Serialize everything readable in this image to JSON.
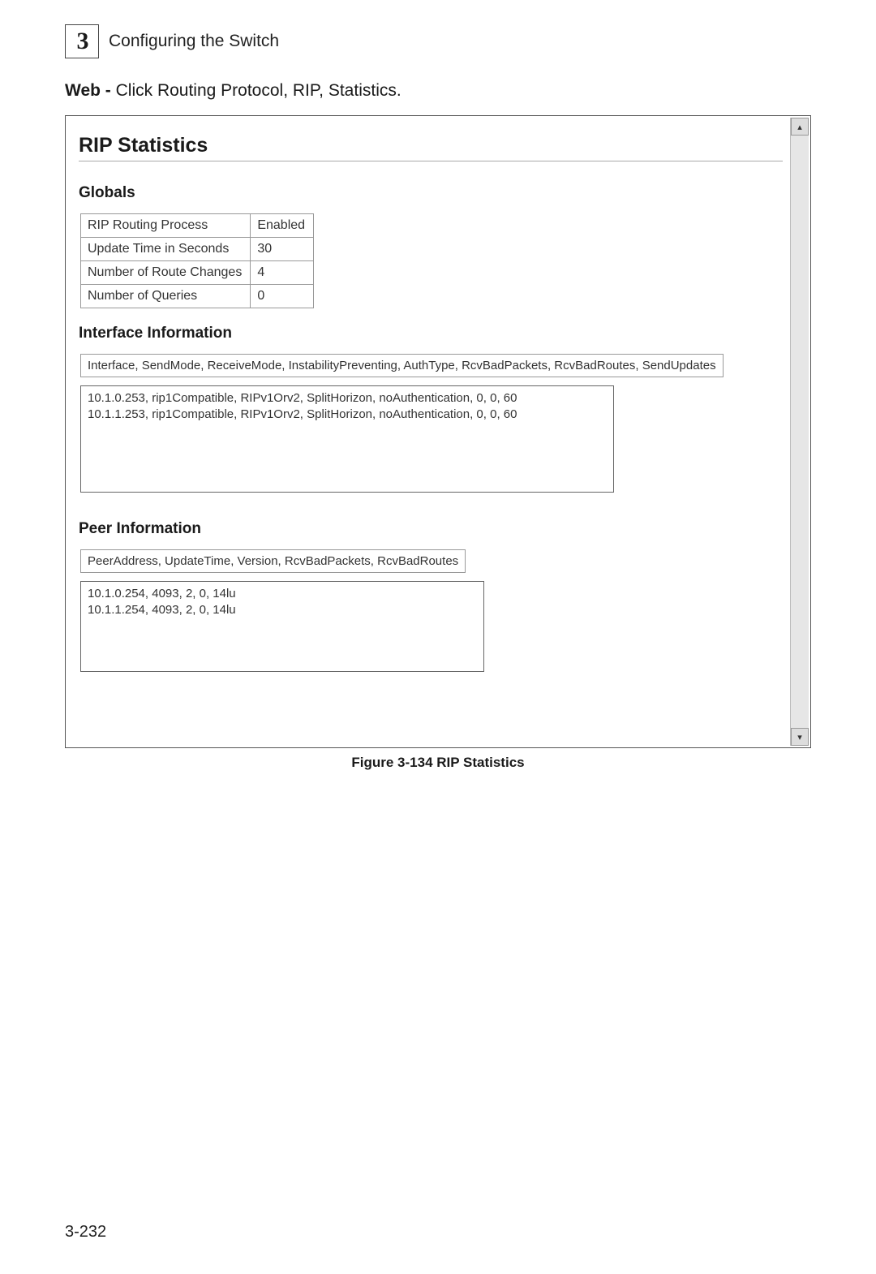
{
  "chapter": {
    "number": "3",
    "title": "Configuring the Switch"
  },
  "intro_prefix": "Web -",
  "intro_suffix": " Click Routing Protocol, RIP, Statistics.",
  "panel": {
    "title": "RIP Statistics",
    "globals_heading": "Globals",
    "globals_rows": [
      {
        "label": "RIP Routing Process",
        "value": "Enabled"
      },
      {
        "label": "Update Time in Seconds",
        "value": "30"
      },
      {
        "label": "Number of Route Changes",
        "value": "4"
      },
      {
        "label": "Number of Queries",
        "value": "0"
      }
    ],
    "iface_heading": "Interface Information",
    "iface_columns": "Interface, SendMode, ReceiveMode, InstabilityPreventing, AuthType, RcvBadPackets, RcvBadRoutes, SendUpdates",
    "iface_rows": [
      "10.1.0.253, rip1Compatible, RIPv1Orv2, SplitHorizon, noAuthentication, 0, 0, 60",
      "10.1.1.253, rip1Compatible, RIPv1Orv2, SplitHorizon, noAuthentication, 0, 0, 60"
    ],
    "peer_heading": "Peer Information",
    "peer_columns": "PeerAddress, UpdateTime, Version, RcvBadPackets, RcvBadRoutes",
    "peer_rows": [
      "10.1.0.254, 4093, 2, 0, 14lu",
      "10.1.1.254, 4093, 2, 0, 14lu"
    ]
  },
  "figure_caption": "Figure 3-134   RIP Statistics",
  "page_number": "3-232",
  "scroll_up_glyph": "▴",
  "scroll_down_glyph": "▾"
}
